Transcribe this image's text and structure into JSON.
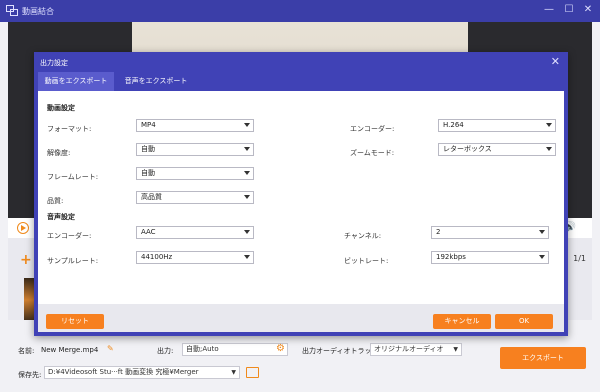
{
  "window": {
    "title": "動画結合",
    "minimize_glyph": "—",
    "maximize_glyph": "☐",
    "close_glyph": "✕"
  },
  "player": {
    "page_indicator": "1/1"
  },
  "bottom": {
    "name_label": "名前:",
    "name_value": "New Merge.mp4",
    "output_label": "出力:",
    "output_value": "自動;Auto",
    "audio_track_label": "出力オーディオトラック:",
    "audio_track_value": "オリジナルオーディオ",
    "save_label": "保存先:",
    "save_path": "D:¥4Videosoft Stu···ft 動画変換 究極¥Merger",
    "export_label": "エクスポート"
  },
  "dialog": {
    "title": "出力設定",
    "close_glyph": "✕",
    "tabs": [
      "動画をエクスポート",
      "音声をエクスポート"
    ],
    "video_section": "動画設定",
    "audio_section": "音声設定",
    "fields": {
      "format": {
        "label": "フォーマット:",
        "value": "MP4"
      },
      "encoder": {
        "label": "エンコーダー:",
        "value": "H.264"
      },
      "resolution": {
        "label": "解像度:",
        "value": "自動"
      },
      "zoom_mode": {
        "label": "ズームモード:",
        "value": "レターボックス"
      },
      "frame_rate": {
        "label": "フレームレート:",
        "value": "自動"
      },
      "quality": {
        "label": "品質:",
        "value": "高品質"
      },
      "audio_encoder": {
        "label": "エンコーダー:",
        "value": "AAC"
      },
      "channel": {
        "label": "チャンネル:",
        "value": "2"
      },
      "sample_rate": {
        "label": "サンプルレート:",
        "value": "44100Hz"
      },
      "bitrate": {
        "label": "ビットレート:",
        "value": "192kbps"
      }
    },
    "reset_label": "リセット",
    "cancel_label": "キャンセル",
    "ok_label": "OK"
  },
  "colors": {
    "accent": "#f7801f",
    "dialog_blue": "#4042b6",
    "titlebar": "#3b3ea8"
  }
}
